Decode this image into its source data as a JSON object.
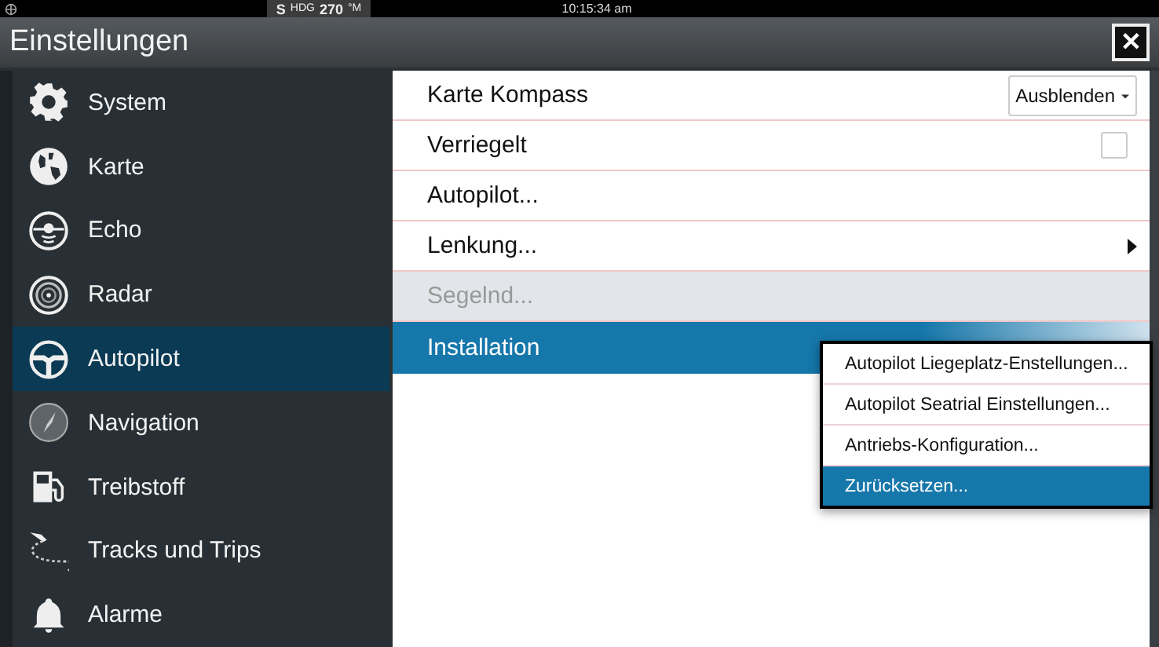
{
  "status_bar": {
    "heading": {
      "direction": "S",
      "label": "HDG",
      "value": "270",
      "unit": "°M"
    },
    "time": "10:15:34 am"
  },
  "window": {
    "title": "Einstellungen",
    "close": "✕"
  },
  "sidebar": {
    "items": [
      {
        "label": "System",
        "selected": false
      },
      {
        "label": "Karte",
        "selected": false
      },
      {
        "label": "Echo",
        "selected": false
      },
      {
        "label": "Radar",
        "selected": false
      },
      {
        "label": "Autopilot",
        "selected": true
      },
      {
        "label": "Navigation",
        "selected": false
      },
      {
        "label": "Treibstoff",
        "selected": false
      },
      {
        "label": "Tracks und Trips",
        "selected": false
      },
      {
        "label": "Alarme",
        "selected": false
      }
    ]
  },
  "settings": {
    "rows": [
      {
        "kind": "dropdown",
        "label": "Karte Kompass",
        "value": "Ausblenden",
        "selected": false,
        "disabled": false
      },
      {
        "kind": "checkbox",
        "label": "Verriegelt",
        "checked": false,
        "selected": false,
        "disabled": false
      },
      {
        "kind": "action",
        "label": "Autopilot...",
        "selected": false,
        "disabled": false
      },
      {
        "kind": "submenu",
        "label": "Lenkung...",
        "selected": false,
        "disabled": false
      },
      {
        "kind": "action",
        "label": "Segelnd...",
        "selected": false,
        "disabled": true
      },
      {
        "kind": "action",
        "label": "Installation",
        "selected": true,
        "disabled": false
      }
    ]
  },
  "popup_menu": {
    "items": [
      {
        "label": "Autopilot Liegeplatz-Enstellungen...",
        "selected": false
      },
      {
        "label": "Autopilot Seatrial Einstellungen...",
        "selected": false
      },
      {
        "label": "Antriebs-Konfiguration...",
        "selected": false
      },
      {
        "label": "Zurücksetzen...",
        "selected": true
      }
    ]
  }
}
